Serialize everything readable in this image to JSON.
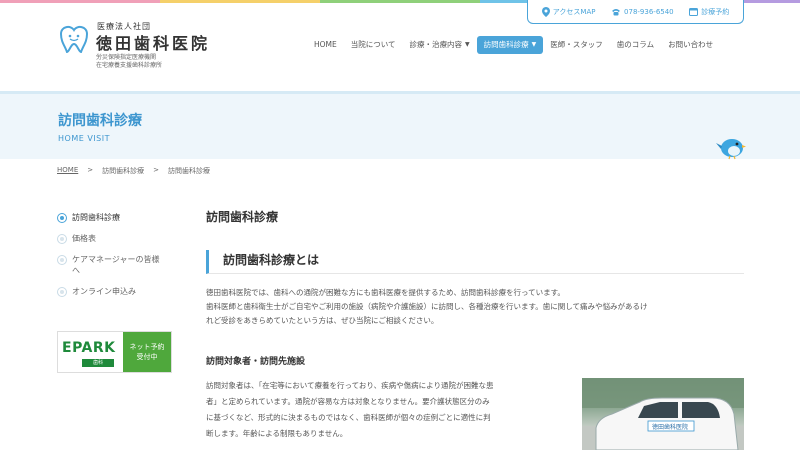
{
  "colors": {
    "accent": "#4aa4d9",
    "topbar": [
      "#f0a0b8",
      "#f5d06a",
      "#8fd07a",
      "#6fc3e8",
      "#b59be0"
    ]
  },
  "logo": {
    "corp": "医療法人社団",
    "name": "徳田歯科医院",
    "sub1": "労災保険指定医療機関",
    "sub2": "在宅療養支援歯科診療所"
  },
  "contact": {
    "access": "アクセスMAP",
    "phone": "078-936-6540",
    "booking": "診療予約"
  },
  "nav": [
    {
      "label": "HOME",
      "caret": false,
      "active": false
    },
    {
      "label": "当院について",
      "caret": false,
      "active": false
    },
    {
      "label": "診療・治療内容",
      "caret": true,
      "active": false
    },
    {
      "label": "訪問歯科診療",
      "caret": true,
      "active": true
    },
    {
      "label": "医師・スタッフ",
      "caret": false,
      "active": false
    },
    {
      "label": "歯のコラム",
      "caret": false,
      "active": false
    },
    {
      "label": "お問い合わせ",
      "caret": false,
      "active": false
    }
  ],
  "hero": {
    "title": "訪問歯科診療",
    "subtitle": "HOME VISIT"
  },
  "breadcrumb": [
    "HOME",
    "訪問歯科診療",
    "訪問歯科診療"
  ],
  "breadcrumb_sep": ">",
  "sidebar": {
    "items": [
      {
        "label": "訪問歯科診療",
        "active": true
      },
      {
        "label": "価格表",
        "active": false
      },
      {
        "label": "ケアマネージャーの皆様へ",
        "active": false
      },
      {
        "label": "オンライン申込み",
        "active": false
      }
    ]
  },
  "epark": {
    "logo": "EPARK",
    "tag": "歯科",
    "line1": "ネット予約",
    "line2": "受付中"
  },
  "main": {
    "title": "訪問歯科診療",
    "section_title": "訪問歯科診療とは",
    "para1_line1": "徳田歯科医院では、歯科への通院が困難な方にも歯科医療を提供するため、訪問歯科診療を行っています。",
    "para1_line2": "歯科医師と歯科衛生士がご自宅やご利用の施設（病院や介護施設）に訪問し、各種治療を行います。歯に関して痛みや悩みがあるけ",
    "para1_line3": "れど受診をあきらめていたという方は、ぜひ当院にご相談ください。",
    "sub_title": "訪問対象者・訪問先施設",
    "para2_line1": "訪問対象者は、「在宅等において療養を行っており、疾病や傷病により通院が困難な患",
    "para2_line2": "者」と定められています。通院が容易な方は対象となりません。要介護状態区分のみ",
    "para2_line3": "に基づくなど、形式的に決まるものではなく、歯科医師が個々の症例ごとに適性に判",
    "para2_line4": "断します。年齢による制限もありません。",
    "car_sign": "徳田歯科医院"
  }
}
